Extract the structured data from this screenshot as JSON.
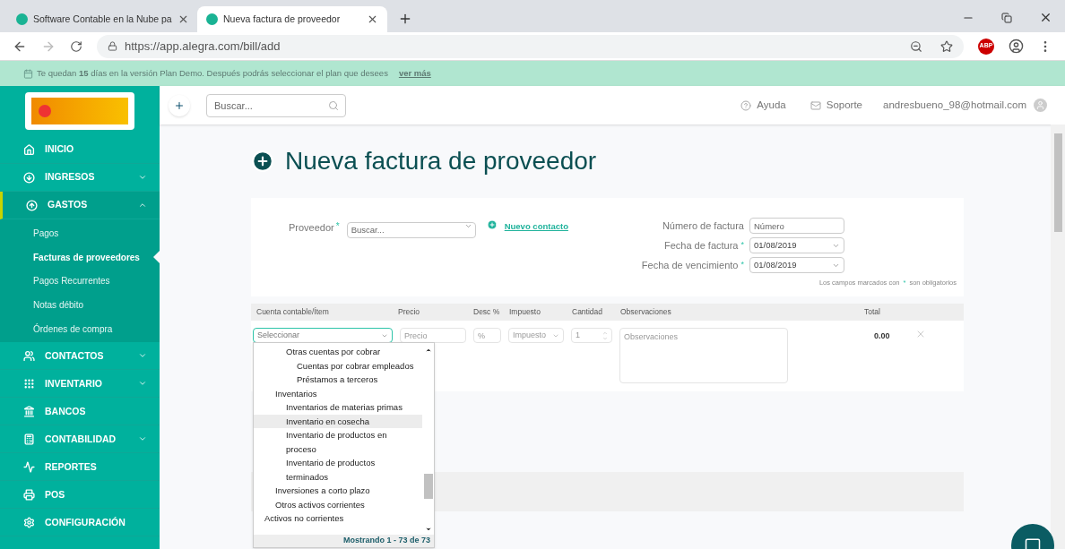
{
  "browser": {
    "tabs": [
      {
        "title": "Software Contable en la Nube pa",
        "selected": false
      },
      {
        "title": "Nueva factura de proveedor",
        "selected": true
      }
    ],
    "url": "https://app.alegra.com/bill/add",
    "extension_badge": "ABP"
  },
  "banner": {
    "text": "Te quedan **15** días en la versión Plan Demo. Después podrás seleccionar el plan que desees",
    "link": "ver más"
  },
  "header": {
    "search": {
      "placeholder": "Buscar..."
    },
    "help": "Ayuda",
    "support": "Soporte",
    "user": "andresbueno_98@hotmail.com"
  },
  "sidebar": {
    "items": [
      {
        "label": "INICIO",
        "kind": "link"
      },
      {
        "label": "INGRESOS",
        "kind": "group",
        "expanded": false
      },
      {
        "label": "GASTOS",
        "kind": "group",
        "expanded": true,
        "children": [
          {
            "label": "Pagos",
            "selected": false
          },
          {
            "label": "Facturas de proveedores",
            "selected": true
          },
          {
            "label": "Pagos Recurrentes",
            "selected": false
          },
          {
            "label": "Notas débito",
            "selected": false
          },
          {
            "label": "Órdenes de compra",
            "selected": false
          }
        ]
      },
      {
        "label": "CONTACTOS",
        "kind": "group",
        "expanded": false
      },
      {
        "label": "INVENTARIO",
        "kind": "group",
        "expanded": false
      },
      {
        "label": "BANCOS",
        "kind": "link"
      },
      {
        "label": "CONTABILIDAD",
        "kind": "group",
        "expanded": false
      },
      {
        "label": "REPORTES",
        "kind": "link"
      },
      {
        "label": "POS",
        "kind": "link"
      },
      {
        "label": "CONFIGURACIÓN",
        "kind": "link"
      }
    ]
  },
  "page": {
    "title": "Nueva factura de proveedor"
  },
  "form": {
    "provider": {
      "label": "Proveedor",
      "mark": "*",
      "placeholder": "Buscar..."
    },
    "new_contact": "Nuevo contacto",
    "fields": [
      {
        "label": "Número de factura",
        "placeholder": "Número",
        "kind": "text"
      },
      {
        "label": "Fecha de factura",
        "mark": "*",
        "value": "01/08/2019",
        "kind": "date"
      },
      {
        "label": "Fecha de vencimiento",
        "mark": "*",
        "value": "01/08/2019",
        "kind": "date"
      }
    ],
    "note": {
      "before": "Los campos marcados con",
      "mark": "*",
      "after": "son obligatorios"
    }
  },
  "table": {
    "columns": [
      "Cuenta contable/Ítem",
      "Precio",
      "Desc %",
      "Impuesto",
      "Cantidad",
      "Observaciones",
      "Total"
    ],
    "row": {
      "account": "Seleccionar",
      "price": {
        "placeholder": "Precio"
      },
      "discount": {
        "placeholder": "%"
      },
      "tax": "Impuesto",
      "quantity": "1",
      "notes": {
        "placeholder": "Observaciones"
      },
      "total": "0.00"
    }
  },
  "dropdown": {
    "options": [
      {
        "children": [
          {
            "children": [
              {
                "label": "Otras cuentas por cobrar",
                "selected": false,
                "children": [
                  {
                    "label": "Cuentas por cobrar empleados",
                    "selected": false
                  },
                  {
                    "label": "Préstamos a terceros",
                    "selected": false
                  }
                ]
              }
            ]
          },
          {
            "label": "Inventarios",
            "selected": false,
            "children": [
              {
                "label": "Inventarios de materias primas",
                "selected": false
              },
              {
                "label": "Inventario en cosecha",
                "selected": true
              },
              {
                "label": "Inventario de productos en proceso",
                "selected": false
              },
              {
                "label": "Inventario de productos terminados",
                "selected": false
              }
            ]
          },
          {
            "label": "Inversiones a corto plazo",
            "selected": false
          },
          {
            "label": "Otros activos corrientes",
            "selected": false
          }
        ]
      },
      {
        "label": "Activos no corrientes",
        "selected": false
      }
    ],
    "footer": "Mostrando 1 - 73 de 73"
  }
}
